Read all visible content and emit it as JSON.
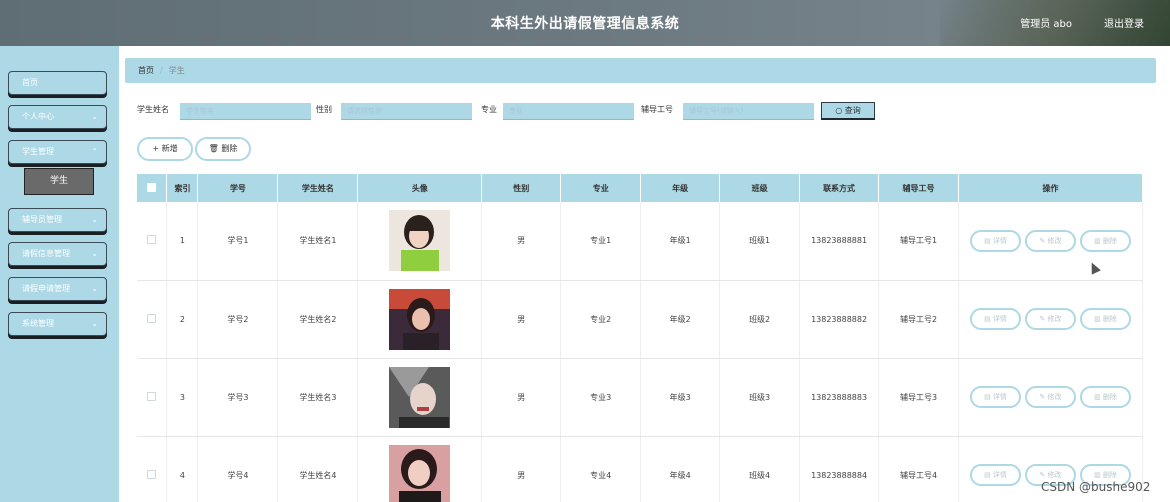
{
  "header": {
    "title": "本科生外出请假管理信息系统",
    "user": "管理员 abo",
    "logout": "退出登录"
  },
  "sidebar": {
    "items": [
      {
        "label": "首页",
        "chevron": false
      },
      {
        "label": "个人中心",
        "chevron": true
      },
      {
        "label": "学生管理",
        "chevron": true
      },
      {
        "label": "辅导员管理",
        "chevron": true
      },
      {
        "label": "请假信息管理",
        "chevron": true
      },
      {
        "label": "请假申请管理",
        "chevron": true
      },
      {
        "label": "系统管理",
        "chevron": true
      }
    ],
    "active_sub": "学生"
  },
  "breadcrumb": {
    "home": "首页",
    "sep": "/",
    "current": "学生"
  },
  "search": {
    "name_label": "学生姓名",
    "name_placeholder": "学生姓名",
    "gender_label": "性别",
    "gender_placeholder": "请选择性别",
    "major_label": "专业",
    "major_placeholder": "专业",
    "tutor_label": "辅导工号",
    "tutor_placeholder": "辅导工号(请输入)",
    "search_button": "查询"
  },
  "actions": {
    "add": "新增",
    "delete": "删除"
  },
  "table": {
    "headers": [
      "",
      "索引",
      "学号",
      "学生姓名",
      "头像",
      "性别",
      "专业",
      "年级",
      "班级",
      "联系方式",
      "辅导工号",
      "操作"
    ],
    "rows": [
      {
        "index": "1",
        "student_id": "学号1",
        "name": "学生姓名1",
        "gender": "男",
        "major": "专业1",
        "grade": "年级1",
        "class": "班级1",
        "phone": "13823888881",
        "tutor": "辅导工号1"
      },
      {
        "index": "2",
        "student_id": "学号2",
        "name": "学生姓名2",
        "gender": "男",
        "major": "专业2",
        "grade": "年级2",
        "class": "班级2",
        "phone": "13823888882",
        "tutor": "辅导工号2"
      },
      {
        "index": "3",
        "student_id": "学号3",
        "name": "学生姓名3",
        "gender": "男",
        "major": "专业3",
        "grade": "年级3",
        "class": "班级3",
        "phone": "13823888883",
        "tutor": "辅导工号3"
      },
      {
        "index": "4",
        "student_id": "学号4",
        "name": "学生姓名4",
        "gender": "男",
        "major": "专业4",
        "grade": "年级4",
        "class": "班级4",
        "phone": "13823888884",
        "tutor": "辅导工号4"
      }
    ],
    "op_labels": {
      "detail": "详情",
      "edit": "修改",
      "delete": "删除"
    }
  },
  "watermark": "CSDN @bushe902",
  "colors": {
    "accent": "#add8e6",
    "header": "#6d7a82"
  }
}
